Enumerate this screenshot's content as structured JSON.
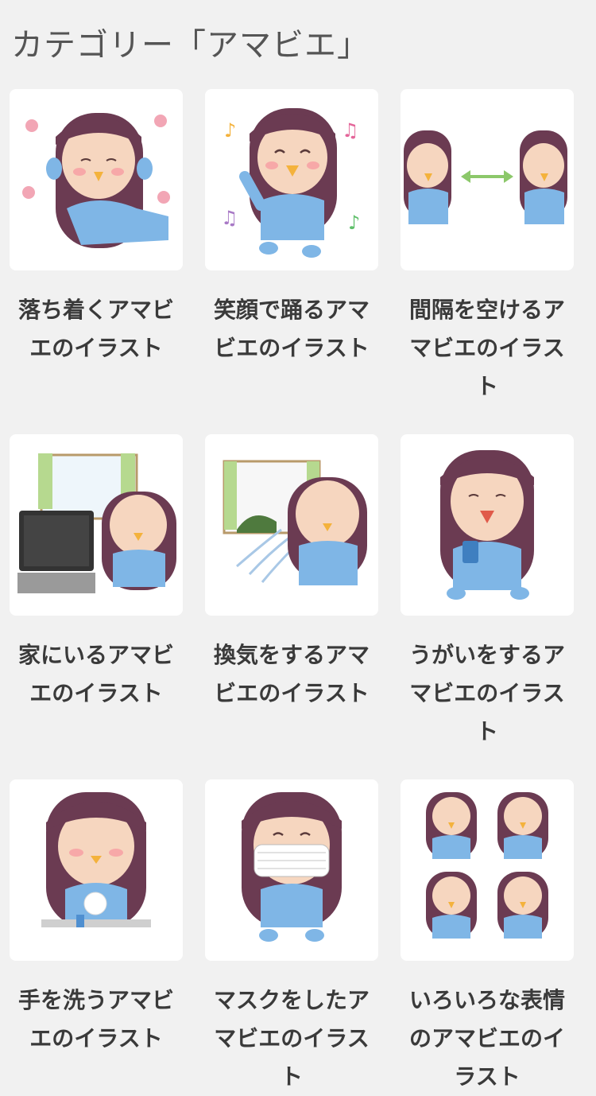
{
  "category_heading": "カテゴリー「アマビエ」",
  "items": [
    {
      "caption": "落ち着くアマビエのイラスト",
      "icon": "amabie-relaxing-icon"
    },
    {
      "caption": "笑顔で踊るアマビエのイラスト",
      "icon": "amabie-dancing-icon"
    },
    {
      "caption": "間隔を空けるアマビエのイラスト",
      "icon": "amabie-distancing-icon"
    },
    {
      "caption": "家にいるアマビエのイラスト",
      "icon": "amabie-home-icon"
    },
    {
      "caption": "換気をするアマビエのイラスト",
      "icon": "amabie-ventilation-icon"
    },
    {
      "caption": "うがいをするアマビエのイラスト",
      "icon": "amabie-gargling-icon"
    },
    {
      "caption": "手を洗うアマビエのイラスト",
      "icon": "amabie-handwashing-icon"
    },
    {
      "caption": "マスクをしたアマビエのイラスト",
      "icon": "amabie-mask-icon"
    },
    {
      "caption": "いろいろな表情のアマビエのイラスト",
      "icon": "amabie-expressions-icon"
    }
  ],
  "colors": {
    "hair": "#6b3b52",
    "body": "#7fb6e6",
    "face": "#f6d6bf",
    "beak": "#f4b23c",
    "card_bg": "#ffffff",
    "page_bg": "#f1f1f1"
  }
}
